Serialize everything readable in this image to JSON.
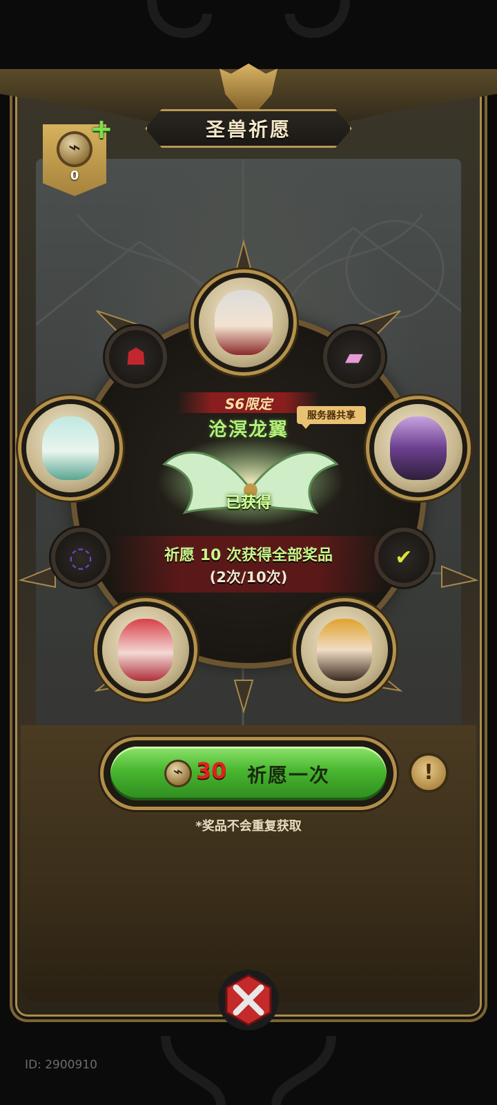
{
  "header": {
    "title": "圣兽祈愿"
  },
  "currency": {
    "value": "0"
  },
  "wheel": {
    "rewards": [
      {
        "name": "hero-silver-fox-portrait"
      },
      {
        "name": "crimson-demon-portrait"
      },
      {
        "name": "card-pack-icon"
      },
      {
        "name": "jade-spirit-portrait"
      },
      {
        "name": "violet-knight-portrait"
      },
      {
        "name": "shadow-ring-icon"
      },
      {
        "name": "obtained-card-icon"
      },
      {
        "name": "crimson-horned-girl-portrait"
      },
      {
        "name": "golden-horn-girl-portrait"
      }
    ]
  },
  "featured": {
    "limited_label": "S6限定",
    "item_name": "沧溟龙翼",
    "server_tag": "服务器共享",
    "status": "已获得"
  },
  "progress": {
    "line1": "祈愿 10 次获得全部奖品",
    "line2": "(2次/10次)",
    "current": 2,
    "total": 10
  },
  "wish_button": {
    "cost": "30",
    "label": "祈愿一次"
  },
  "note": "*奖品不会重复获取",
  "footer": {
    "id_text": "ID: 2900910"
  },
  "colors": {
    "accent_gold": "#b89a55",
    "button_green": "#48b62f",
    "cost_red": "#e0201d",
    "name_green": "#b6f07c"
  }
}
